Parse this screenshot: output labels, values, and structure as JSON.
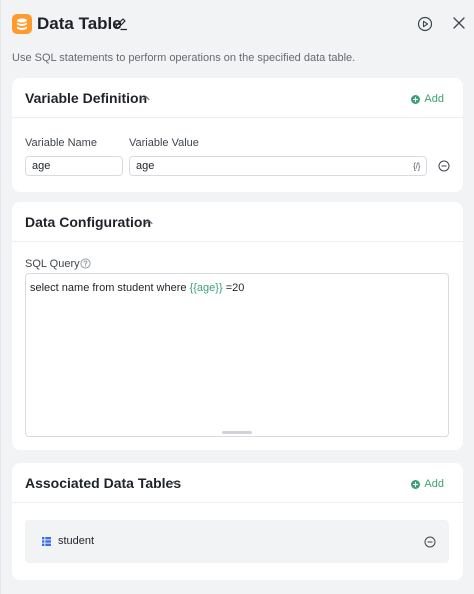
{
  "header": {
    "title": "Data Table",
    "description": "Use SQL statements to perform operations on the specified data table.",
    "icons": {
      "logo": "database-icon",
      "edit": "pencil-icon",
      "run": "play-circle-icon",
      "close": "close-icon"
    }
  },
  "variable_definition": {
    "title": "Variable Definition",
    "add_label": "Add",
    "name_label": "Variable Name",
    "value_label": "Variable Value",
    "rows": [
      {
        "name": "age",
        "value": "age",
        "var_tag": "{/}"
      }
    ]
  },
  "data_configuration": {
    "title": "Data Configuration",
    "sql_label": "SQL Query",
    "sql_prefix": "select name from student where ",
    "sql_variable": "{{age}}",
    "sql_suffix": " =20"
  },
  "associated_tables": {
    "title": "Associated Data Tables",
    "add_label": "Add",
    "tables": [
      {
        "name": "student"
      }
    ]
  },
  "colors": {
    "accent": "#3ba176",
    "logo": "#ff9a2e",
    "table_icon": "#3b6ee8"
  }
}
